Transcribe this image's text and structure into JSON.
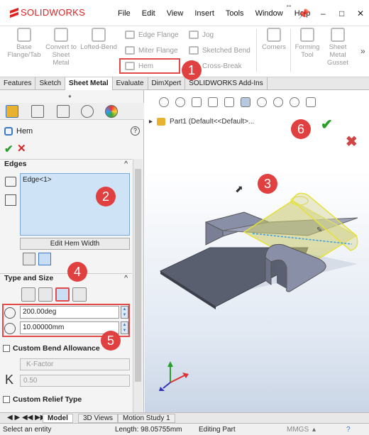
{
  "app": {
    "logo_text": "SOLIDWORKS"
  },
  "menu": [
    "File",
    "Edit",
    "View",
    "Insert",
    "Tools",
    "Window",
    "Help"
  ],
  "window_controls": {
    "minimize": "–",
    "restore": "□",
    "close": "✕",
    "resize_arrow": "↔"
  },
  "ribbon": {
    "base_flange": "Base Flange/Tab",
    "convert": "Convert to Sheet Metal",
    "lofted": "Lofted-Bend",
    "edge_flange": "Edge Flange",
    "miter_flange": "Miter Flange",
    "hem": "Hem",
    "jog": "Jog",
    "sketched_bend": "Sketched Bend",
    "cross_break": "Cross-Break",
    "corners": "Corners",
    "forming_tool": "Forming Tool",
    "gusset": "Sheet Metal Gusset",
    "more": "»"
  },
  "tabs": [
    "Features",
    "Sketch",
    "Sheet Metal",
    "Evaluate",
    "DimXpert",
    "SOLIDWORKS Add-Ins"
  ],
  "active_tab": "Sheet Metal",
  "property_manager": {
    "title": "Hem",
    "help": "?",
    "ok": "✔",
    "cancel": "✕",
    "edges_header": "Edges",
    "edge_item": "Edge<1>",
    "edit_hem_width": "Edit Hem Width",
    "type_size_header": "Type and Size",
    "angle_value": "200.00deg",
    "radius_value": "10.00000mm",
    "custom_bend_allowance": "Custom Bend Allowance",
    "k_factor_select": "K-Factor",
    "k_label": "K",
    "k_value": "0.50",
    "custom_relief": "Custom Relief Type",
    "collapse": "^"
  },
  "viewport": {
    "tree_label": "Part1  (Default<<Default>...",
    "tree_expand": "▸",
    "ok": "✔",
    "cancel": "✖"
  },
  "callouts": [
    "1",
    "2",
    "3",
    "4",
    "5",
    "6"
  ],
  "bottom_tabs": [
    "Model",
    "3D Views",
    "Motion Study 1"
  ],
  "status": {
    "left": "Select an entity",
    "length": "Length: 98.05755mm",
    "mode": "Editing Part",
    "units": "MMGS"
  },
  "colors": {
    "callout": "#e04040",
    "highlight_border": "#e24a4a",
    "brand_red": "#d22222",
    "selection": "#cfe3f7"
  }
}
